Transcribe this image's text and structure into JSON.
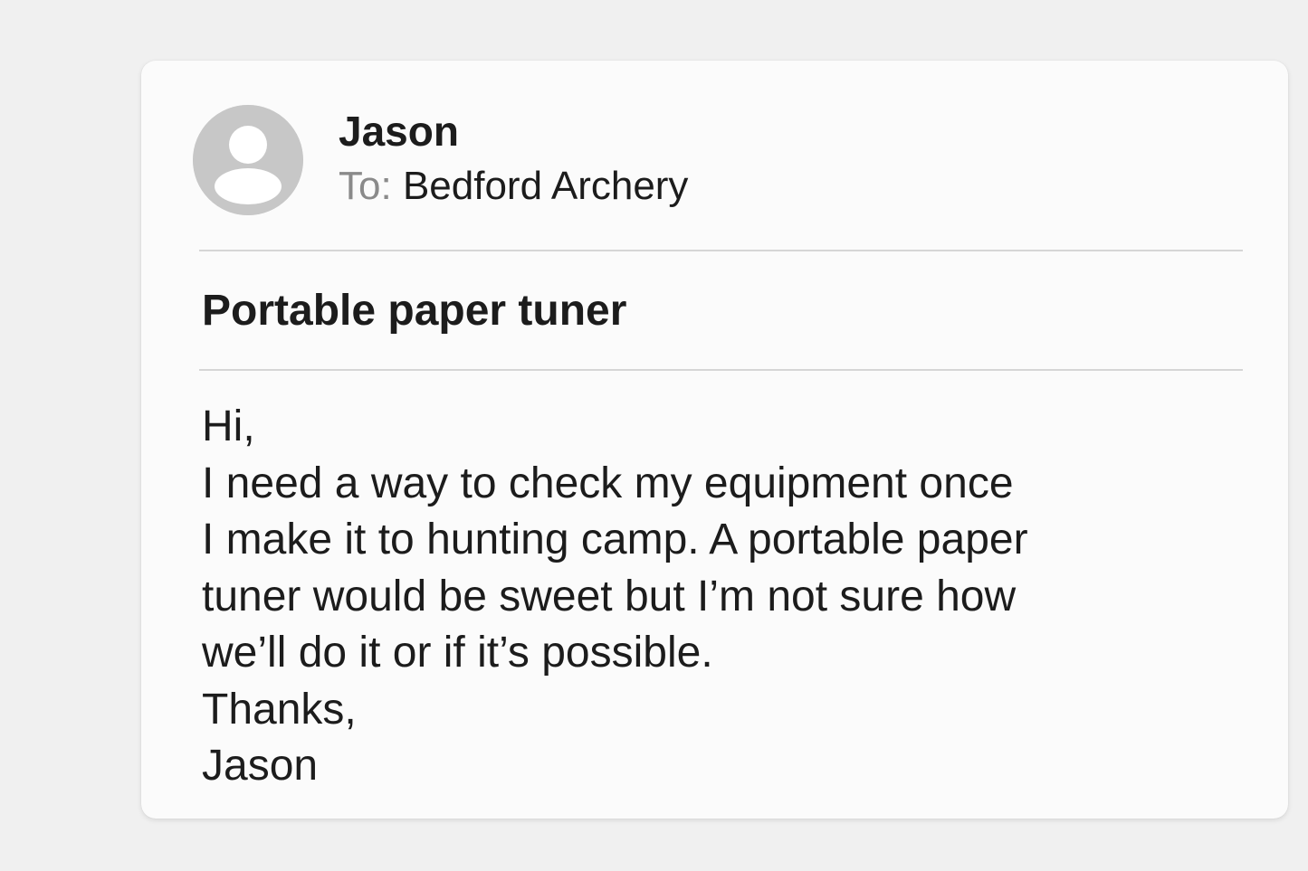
{
  "email": {
    "sender": "Jason",
    "recipient_label": "To:",
    "recipient": "Bedford Archery",
    "subject": "Portable paper tuner",
    "body_lines": [
      "Hi,",
      "I need a way to check my equipment once",
      "I make it to hunting camp. A portable paper",
      "tuner would be sweet but I’m not sure how",
      "we’ll do it or if it’s possible.",
      "Thanks,",
      "Jason"
    ]
  },
  "icons": {
    "avatar": "user-avatar-icon"
  },
  "colors": {
    "background": "#f0f0f0",
    "card": "#fbfbfb",
    "avatar": "#c7c7c7",
    "divider": "#d6d6d6",
    "muted_label": "#8a8a8a",
    "text": "#1c1c1c"
  }
}
